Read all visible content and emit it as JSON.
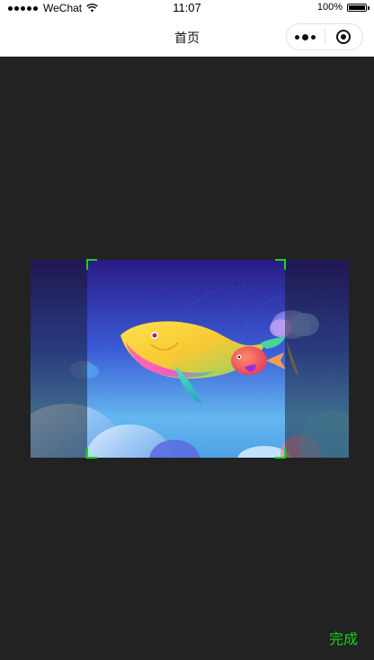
{
  "status_bar": {
    "carrier": "WeChat",
    "time": "11:07",
    "battery": "100%",
    "signal_icon": "signal-dots-icon",
    "wifi_icon": "wifi-icon",
    "battery_icon": "battery-icon"
  },
  "nav": {
    "title": "首页",
    "more_icon": "more-dots-icon",
    "close_icon": "miniprogram-close-icon"
  },
  "cropper": {
    "image_subject": "whale-and-fish-illustration",
    "frame_color": "#18d418"
  },
  "footer": {
    "done_label": "完成",
    "done_color": "#1ad01a"
  }
}
